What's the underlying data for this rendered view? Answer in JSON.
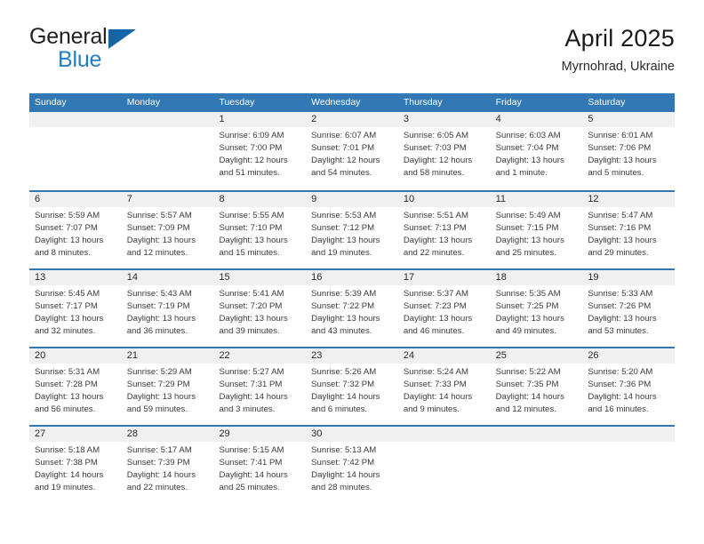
{
  "brand": {
    "name_dark": "General",
    "name_blue": "Blue",
    "logo_color": "#1565a8",
    "blue_text_color": "#1f7fc4"
  },
  "header": {
    "title": "April 2025",
    "subtitle": "Myrnohrad, Ukraine"
  },
  "theme": {
    "header_blue": "#3178b5",
    "date_band_gray": "#f0f0f0",
    "text_color": "#2b2b2b"
  },
  "weekdays": [
    "Sunday",
    "Monday",
    "Tuesday",
    "Wednesday",
    "Thursday",
    "Friday",
    "Saturday"
  ],
  "weeks": [
    [
      {
        "day": "",
        "lines": []
      },
      {
        "day": "",
        "lines": []
      },
      {
        "day": "1",
        "lines": [
          "Sunrise: 6:09 AM",
          "Sunset: 7:00 PM",
          "Daylight: 12 hours",
          "and 51 minutes."
        ]
      },
      {
        "day": "2",
        "lines": [
          "Sunrise: 6:07 AM",
          "Sunset: 7:01 PM",
          "Daylight: 12 hours",
          "and 54 minutes."
        ]
      },
      {
        "day": "3",
        "lines": [
          "Sunrise: 6:05 AM",
          "Sunset: 7:03 PM",
          "Daylight: 12 hours",
          "and 58 minutes."
        ]
      },
      {
        "day": "4",
        "lines": [
          "Sunrise: 6:03 AM",
          "Sunset: 7:04 PM",
          "Daylight: 13 hours",
          "and 1 minute."
        ]
      },
      {
        "day": "5",
        "lines": [
          "Sunrise: 6:01 AM",
          "Sunset: 7:06 PM",
          "Daylight: 13 hours",
          "and 5 minutes."
        ]
      }
    ],
    [
      {
        "day": "6",
        "lines": [
          "Sunrise: 5:59 AM",
          "Sunset: 7:07 PM",
          "Daylight: 13 hours",
          "and 8 minutes."
        ]
      },
      {
        "day": "7",
        "lines": [
          "Sunrise: 5:57 AM",
          "Sunset: 7:09 PM",
          "Daylight: 13 hours",
          "and 12 minutes."
        ]
      },
      {
        "day": "8",
        "lines": [
          "Sunrise: 5:55 AM",
          "Sunset: 7:10 PM",
          "Daylight: 13 hours",
          "and 15 minutes."
        ]
      },
      {
        "day": "9",
        "lines": [
          "Sunrise: 5:53 AM",
          "Sunset: 7:12 PM",
          "Daylight: 13 hours",
          "and 19 minutes."
        ]
      },
      {
        "day": "10",
        "lines": [
          "Sunrise: 5:51 AM",
          "Sunset: 7:13 PM",
          "Daylight: 13 hours",
          "and 22 minutes."
        ]
      },
      {
        "day": "11",
        "lines": [
          "Sunrise: 5:49 AM",
          "Sunset: 7:15 PM",
          "Daylight: 13 hours",
          "and 25 minutes."
        ]
      },
      {
        "day": "12",
        "lines": [
          "Sunrise: 5:47 AM",
          "Sunset: 7:16 PM",
          "Daylight: 13 hours",
          "and 29 minutes."
        ]
      }
    ],
    [
      {
        "day": "13",
        "lines": [
          "Sunrise: 5:45 AM",
          "Sunset: 7:17 PM",
          "Daylight: 13 hours",
          "and 32 minutes."
        ]
      },
      {
        "day": "14",
        "lines": [
          "Sunrise: 5:43 AM",
          "Sunset: 7:19 PM",
          "Daylight: 13 hours",
          "and 36 minutes."
        ]
      },
      {
        "day": "15",
        "lines": [
          "Sunrise: 5:41 AM",
          "Sunset: 7:20 PM",
          "Daylight: 13 hours",
          "and 39 minutes."
        ]
      },
      {
        "day": "16",
        "lines": [
          "Sunrise: 5:39 AM",
          "Sunset: 7:22 PM",
          "Daylight: 13 hours",
          "and 43 minutes."
        ]
      },
      {
        "day": "17",
        "lines": [
          "Sunrise: 5:37 AM",
          "Sunset: 7:23 PM",
          "Daylight: 13 hours",
          "and 46 minutes."
        ]
      },
      {
        "day": "18",
        "lines": [
          "Sunrise: 5:35 AM",
          "Sunset: 7:25 PM",
          "Daylight: 13 hours",
          "and 49 minutes."
        ]
      },
      {
        "day": "19",
        "lines": [
          "Sunrise: 5:33 AM",
          "Sunset: 7:26 PM",
          "Daylight: 13 hours",
          "and 53 minutes."
        ]
      }
    ],
    [
      {
        "day": "20",
        "lines": [
          "Sunrise: 5:31 AM",
          "Sunset: 7:28 PM",
          "Daylight: 13 hours",
          "and 56 minutes."
        ]
      },
      {
        "day": "21",
        "lines": [
          "Sunrise: 5:29 AM",
          "Sunset: 7:29 PM",
          "Daylight: 13 hours",
          "and 59 minutes."
        ]
      },
      {
        "day": "22",
        "lines": [
          "Sunrise: 5:27 AM",
          "Sunset: 7:31 PM",
          "Daylight: 14 hours",
          "and 3 minutes."
        ]
      },
      {
        "day": "23",
        "lines": [
          "Sunrise: 5:26 AM",
          "Sunset: 7:32 PM",
          "Daylight: 14 hours",
          "and 6 minutes."
        ]
      },
      {
        "day": "24",
        "lines": [
          "Sunrise: 5:24 AM",
          "Sunset: 7:33 PM",
          "Daylight: 14 hours",
          "and 9 minutes."
        ]
      },
      {
        "day": "25",
        "lines": [
          "Sunrise: 5:22 AM",
          "Sunset: 7:35 PM",
          "Daylight: 14 hours",
          "and 12 minutes."
        ]
      },
      {
        "day": "26",
        "lines": [
          "Sunrise: 5:20 AM",
          "Sunset: 7:36 PM",
          "Daylight: 14 hours",
          "and 16 minutes."
        ]
      }
    ],
    [
      {
        "day": "27",
        "lines": [
          "Sunrise: 5:18 AM",
          "Sunset: 7:38 PM",
          "Daylight: 14 hours",
          "and 19 minutes."
        ]
      },
      {
        "day": "28",
        "lines": [
          "Sunrise: 5:17 AM",
          "Sunset: 7:39 PM",
          "Daylight: 14 hours",
          "and 22 minutes."
        ]
      },
      {
        "day": "29",
        "lines": [
          "Sunrise: 5:15 AM",
          "Sunset: 7:41 PM",
          "Daylight: 14 hours",
          "and 25 minutes."
        ]
      },
      {
        "day": "30",
        "lines": [
          "Sunrise: 5:13 AM",
          "Sunset: 7:42 PM",
          "Daylight: 14 hours",
          "and 28 minutes."
        ]
      },
      {
        "day": "",
        "lines": []
      },
      {
        "day": "",
        "lines": []
      },
      {
        "day": "",
        "lines": []
      }
    ]
  ]
}
